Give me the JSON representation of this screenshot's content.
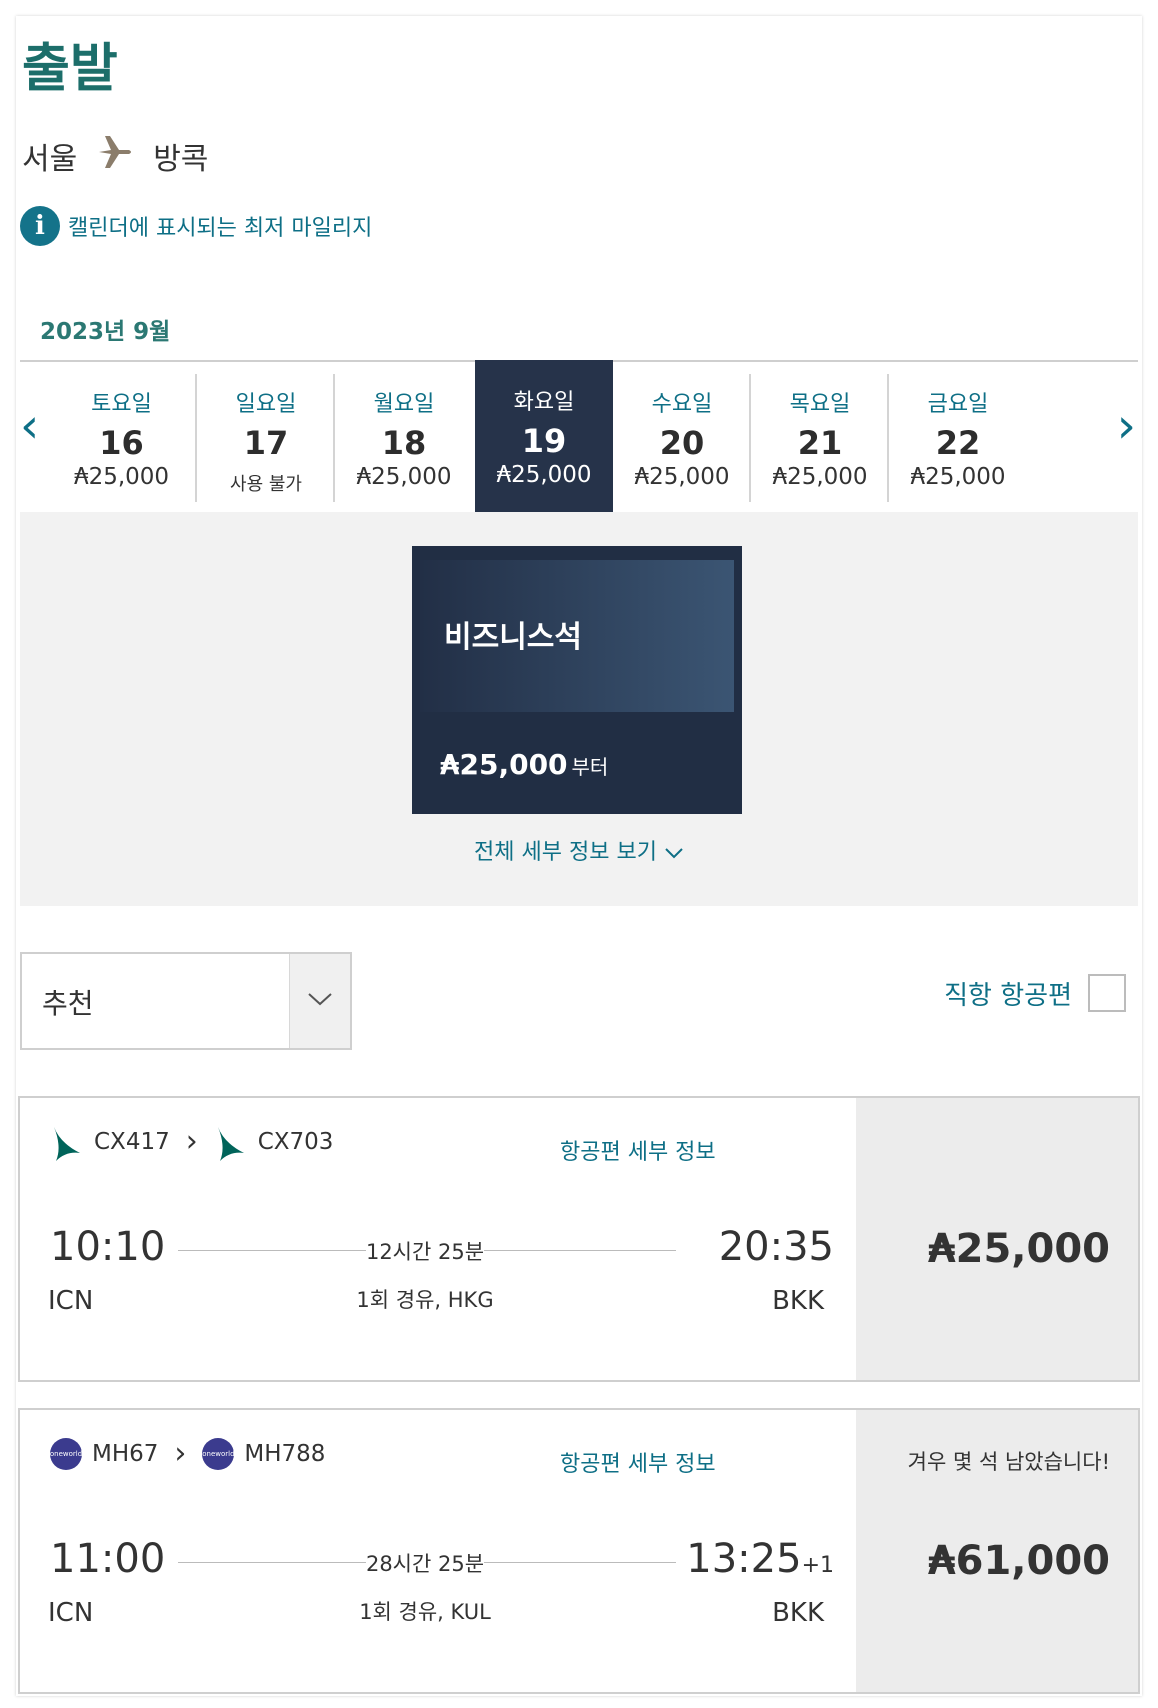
{
  "header": {
    "title": "출발",
    "origin": "서울",
    "destination": "방콕",
    "info_text": "캘린더에 표시되는 최저 마일리지",
    "info_icon": "i"
  },
  "calendar": {
    "month_label": "2023년 9월",
    "days": [
      {
        "name": "토요일",
        "num": "16",
        "price": "₳25,000",
        "selected": false
      },
      {
        "name": "일요일",
        "num": "17",
        "price": "사용 불가",
        "selected": false
      },
      {
        "name": "월요일",
        "num": "18",
        "price": "₳25,000",
        "selected": false
      },
      {
        "name": "화요일",
        "num": "19",
        "price": "₳25,000",
        "selected": true
      },
      {
        "name": "수요일",
        "num": "20",
        "price": "₳25,000",
        "selected": false
      },
      {
        "name": "목요일",
        "num": "21",
        "price": "₳25,000",
        "selected": false
      },
      {
        "name": "금요일",
        "num": "22",
        "price": "₳25,000",
        "selected": false
      }
    ]
  },
  "cabin": {
    "name": "비즈니스석",
    "price": "₳25,000",
    "from_label": "부터",
    "details_link": "전체 세부 정보 보기"
  },
  "filters": {
    "sort_value": "추천",
    "nonstop_label": "직항 항공편"
  },
  "results": [
    {
      "flight1": "CX417",
      "flight2": "CX703",
      "details_label": "항공편 세부 정보",
      "dep_time": "10:10",
      "dep_airport": "ICN",
      "arr_time": "20:35",
      "arr_day_offset": "",
      "arr_airport": "BKK",
      "duration": "12시간 25분",
      "stops": "1회 경유, HKG",
      "price": "₳25,000",
      "availability_note": "",
      "airline": "cathay"
    },
    {
      "flight1": "MH67",
      "flight2": "MH788",
      "details_label": "항공편 세부 정보",
      "dep_time": "11:00",
      "dep_airport": "ICN",
      "arr_time": "13:25",
      "arr_day_offset": "+1",
      "arr_airport": "BKK",
      "duration": "28시간 25분",
      "stops": "1회 경유, KUL",
      "price": "₳61,000",
      "availability_note": "겨우 몇 석 남았습니다!",
      "airline": "oneworld",
      "logo_text": "oneworld"
    }
  ],
  "colors": {
    "teal_title": "#1c6e6a",
    "link_blue": "#0e6f86",
    "selected_day": "#26334a",
    "cabin_card": "#212e44"
  }
}
